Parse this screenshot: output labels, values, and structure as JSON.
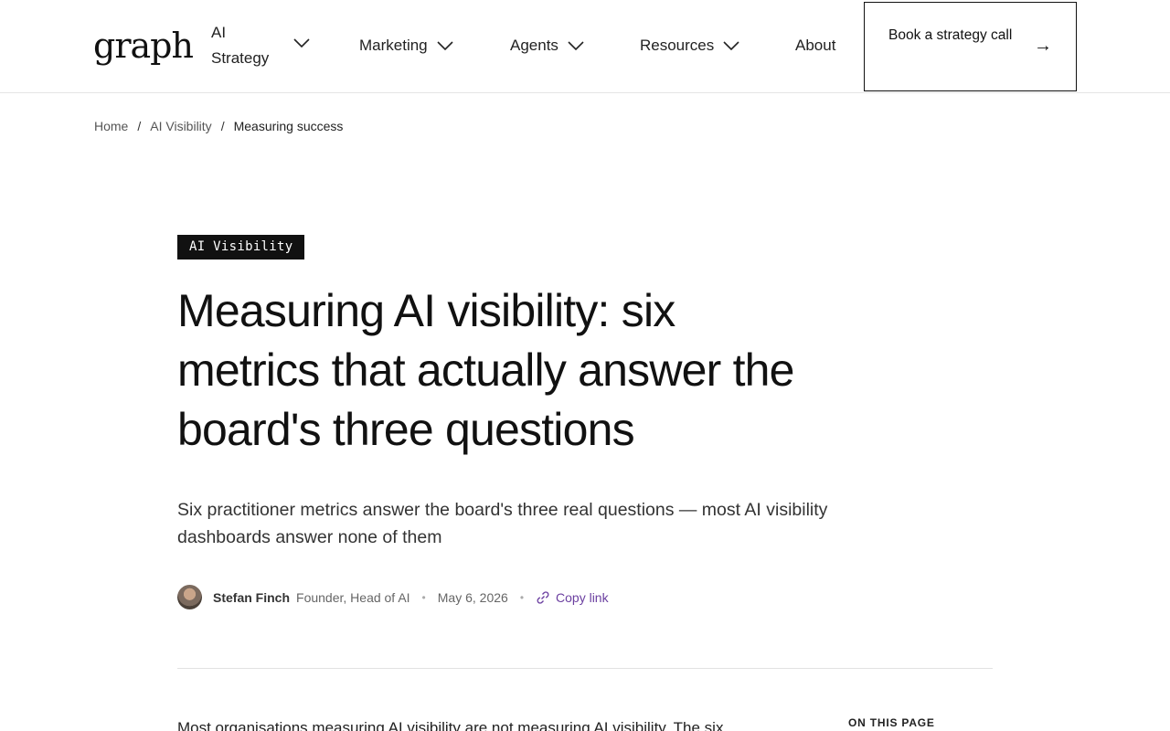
{
  "header": {
    "logo": "graph",
    "nav": [
      {
        "label": "AI Strategy"
      },
      {
        "label": "Marketing"
      },
      {
        "label": "Agents"
      },
      {
        "label": "Resources"
      },
      {
        "label": "About"
      }
    ],
    "cta_label": "Book a strategy call",
    "cta_arrow": "→"
  },
  "breadcrumb": {
    "items": [
      "Home",
      "AI Visibility"
    ],
    "current": "Measuring success",
    "separator": "/"
  },
  "article": {
    "tag": "AI Visibility",
    "title": "Measuring AI visibility: six metrics that actually answer the board's three questions",
    "subtitle": "Six practitioner metrics answer the board's three real questions — most AI visibility dashboards answer none of them",
    "author": "Stefan Finch",
    "role": "Founder, Head of AI",
    "date": "May 6, 2026",
    "copy_link": "Copy link",
    "body_start": "Most organisations measuring AI visibility are not measuring AI visibility. The six"
  },
  "toc": {
    "heading": "ON THIS PAGE"
  },
  "colors": {
    "accent_link": "#6b3fa0",
    "tag_bg": "#111111"
  }
}
